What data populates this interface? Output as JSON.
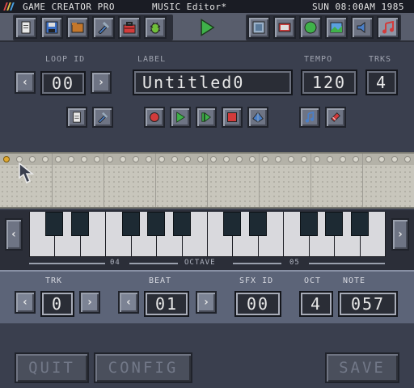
{
  "menubar": {
    "app": "GAME CREATOR PRO",
    "doc": "MUSIC Editor*",
    "clock": "SUN 08:00AM 1985"
  },
  "toolbar": {
    "icons": [
      "new-file-icon",
      "save-disk-icon",
      "folder-icon",
      "tools-icon",
      "toolbox-icon",
      "bug-icon",
      "play-icon",
      "sprite-editor-icon",
      "tile-editor-icon",
      "map-editor-icon",
      "world-editor-icon",
      "sound-editor-icon",
      "music-editor-icon"
    ]
  },
  "loop": {
    "label": "LOOP ID",
    "value": "00"
  },
  "label_field": {
    "label": "LABEL",
    "value": "Untitled0"
  },
  "tempo": {
    "label": "TEMPO",
    "value": "120"
  },
  "trks": {
    "label": "TRKS",
    "value": "4"
  },
  "octave": {
    "left": "04",
    "center": "OCTAVE",
    "right": "05"
  },
  "track": {
    "label": "TRK",
    "value": "0"
  },
  "beat": {
    "label": "BEAT",
    "value": "01"
  },
  "sfx": {
    "label": "SFX ID",
    "value": "00"
  },
  "oct": {
    "label": "OCT",
    "value": "4"
  },
  "note": {
    "label": "NOTE",
    "value": "057"
  },
  "footer": {
    "quit": "QUIT",
    "config": "CONFIG",
    "save": "SAVE"
  },
  "colors": {
    "accent_red": "#d23b3b",
    "accent_green": "#3fb24a",
    "piano_black": "#1d2a33",
    "seq_bg": "#c8c6bc"
  }
}
